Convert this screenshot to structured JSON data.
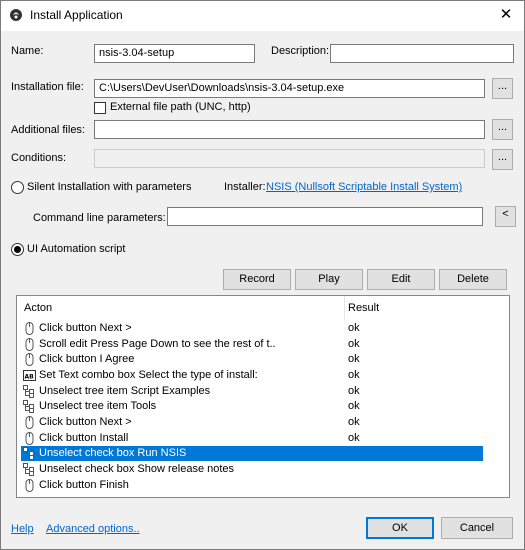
{
  "window": {
    "title": "Install Application",
    "close_glyph": "✕"
  },
  "form": {
    "name_label": "Name:",
    "name_value": "nsis-3.04-setup",
    "description_label": "Description:",
    "description_value": "",
    "installation_file_label": "Installation file:",
    "installation_file_value": "C:\\Users\\DevUser\\Downloads\\nsis-3.04-setup.exe",
    "external_path_label": "External file path (UNC, http)",
    "external_path_checked": false,
    "additional_files_label": "Additional files:",
    "additional_files_value": "",
    "conditions_label": "Conditions:",
    "conditions_value": "",
    "browse_label": "...",
    "silent_label": "Silent Installation with parameters",
    "installer_label": "Installer:",
    "installer_link": "NSIS (Nullsoft Scriptable Install System)",
    "cmdline_label": "Command line parameters:",
    "cmdline_value": "",
    "cmdline_button": "<",
    "ui_automation_label": "UI Automation script",
    "selected_mode": "ui_automation"
  },
  "script_toolbar": {
    "record": "Record",
    "play": "Play",
    "edit": "Edit",
    "delete": "Delete"
  },
  "script_list": {
    "headers": {
      "action": "Acton",
      "result": "Result"
    },
    "rows": [
      {
        "icon": "mouse-icon",
        "action": "Click button Next >",
        "result": "ok"
      },
      {
        "icon": "mouse-icon",
        "action": "Scroll edit Press Page Down to see the rest of t..",
        "result": "ok"
      },
      {
        "icon": "mouse-icon",
        "action": "Click button I Agree",
        "result": "ok"
      },
      {
        "icon": "text-field-icon",
        "action": "Set Text combo box Select the type of install:",
        "result": "ok"
      },
      {
        "icon": "tree-icon",
        "action": "Unselect tree item Script Examples",
        "result": "ok"
      },
      {
        "icon": "tree-icon",
        "action": "Unselect tree item Tools",
        "result": "ok"
      },
      {
        "icon": "mouse-icon",
        "action": "Click button Next >",
        "result": "ok"
      },
      {
        "icon": "mouse-icon",
        "action": "Click button Install",
        "result": "ok"
      },
      {
        "icon": "tree-icon",
        "action": "Unselect check box Run NSIS",
        "result": "",
        "selected": true
      },
      {
        "icon": "tree-icon",
        "action": "Unselect check box Show release notes",
        "result": ""
      },
      {
        "icon": "mouse-icon",
        "action": "Click button Finish",
        "result": ""
      }
    ]
  },
  "footer": {
    "help": "Help",
    "advanced": "Advanced options..",
    "ok": "OK",
    "cancel": "Cancel"
  },
  "colors": {
    "selection": "#0078d7",
    "link": "#0066cc",
    "background": "#f0f0f0"
  }
}
